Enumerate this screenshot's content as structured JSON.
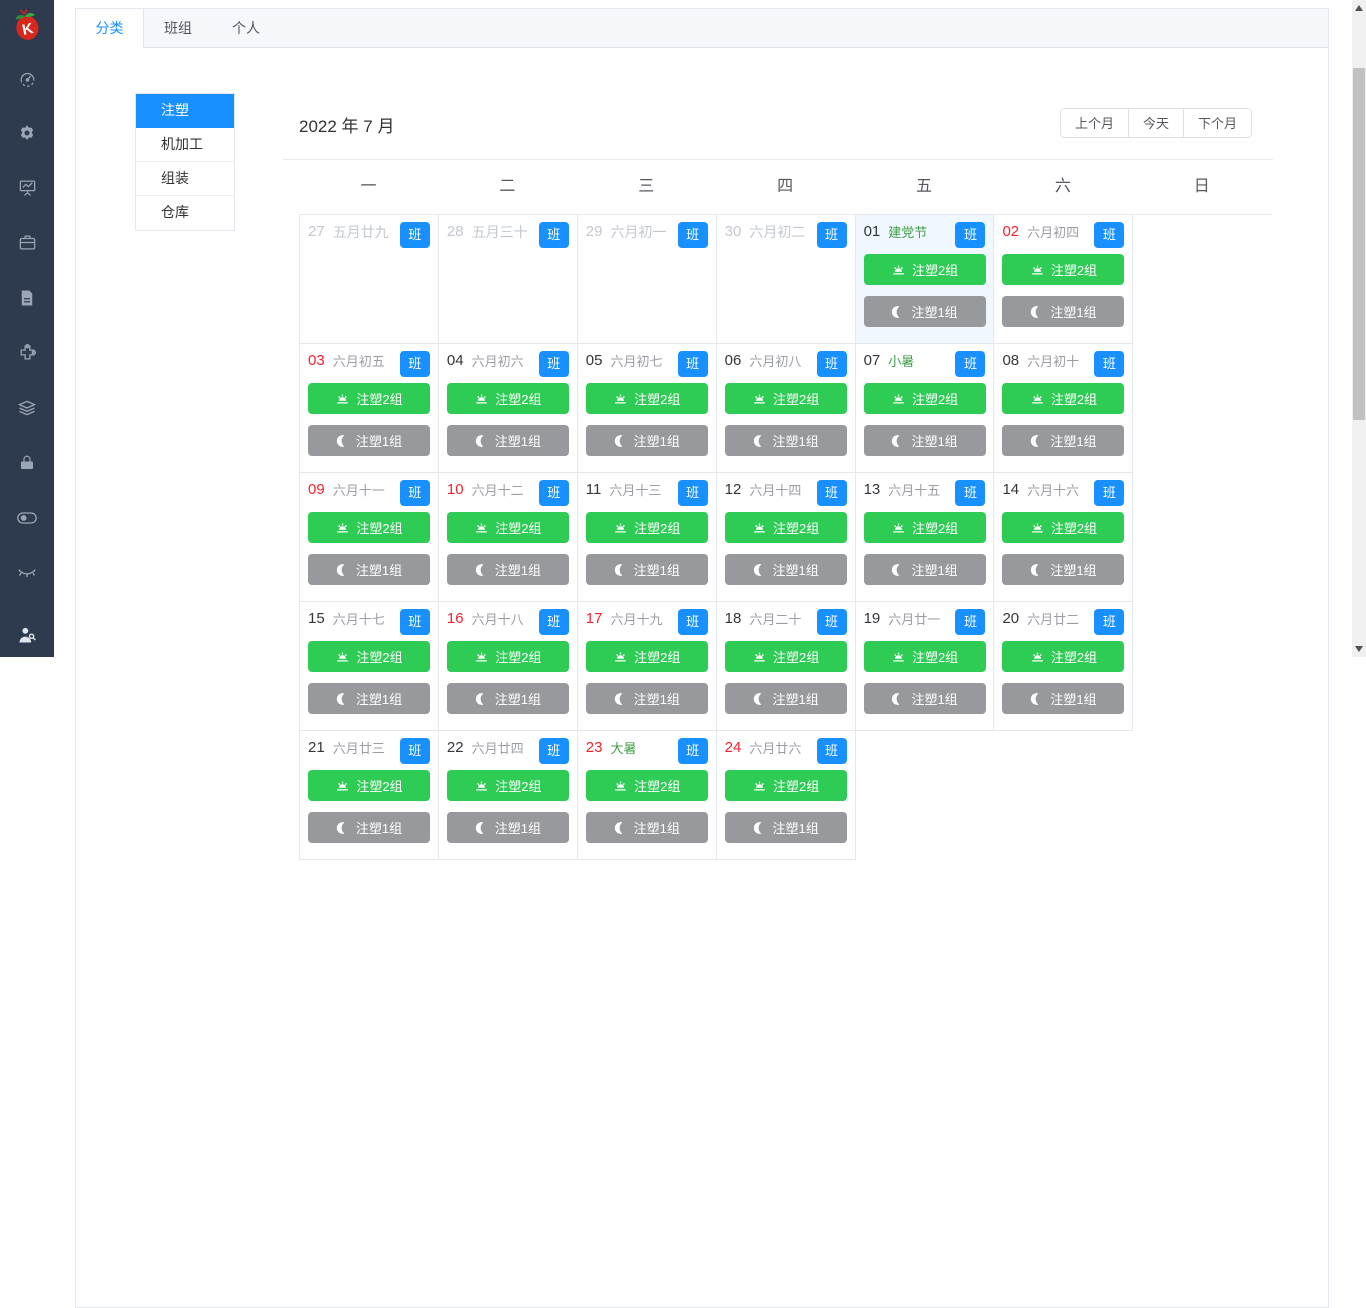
{
  "colors": {
    "primary_blue": "#1890ff",
    "shift_day_green": "#2ecc55",
    "shift_night_gray": "#97999c",
    "weekend_red": "#f5222d",
    "holiday_green": "#3f9e46",
    "sidebar_bg": "#2e3a4d",
    "prev_month_gray": "#c3c8d0",
    "today_cell_bg": "#f0f7fe"
  },
  "sidebar": {
    "logo": "app-logo-strawberry",
    "icons": [
      "dashboard-gauge-icon",
      "settings-gear-icon",
      "chart-board-icon",
      "briefcase-icon",
      "document-icon",
      "puzzle-icon",
      "layers-icon",
      "lock-icon",
      "toggle-icon",
      "eye-closed-icon"
    ],
    "bottom_icon": "users-icon"
  },
  "tabs": [
    {
      "label": "分类",
      "active": true
    },
    {
      "label": "班组",
      "active": false
    },
    {
      "label": "个人",
      "active": false
    }
  ],
  "category_menu": [
    {
      "label": "注塑",
      "selected": true
    },
    {
      "label": "机加工",
      "selected": false
    },
    {
      "label": "组装",
      "selected": false
    },
    {
      "label": "仓库",
      "selected": false
    }
  ],
  "calendar": {
    "title": "2022 年 7 月",
    "nav_buttons": [
      "上个月",
      "今天",
      "下个月"
    ],
    "weekdays": [
      "一",
      "二",
      "三",
      "四",
      "五",
      "六",
      "日"
    ],
    "badge_label": "班",
    "day_shift_label": "注塑2组",
    "night_shift_label": "注塑1组",
    "days": [
      {
        "day": "27",
        "lunar": "五月廿九",
        "num_style": "prev",
        "lunar_style": "prev",
        "highlight": false,
        "shifts": false
      },
      {
        "day": "28",
        "lunar": "五月三十",
        "num_style": "prev",
        "lunar_style": "prev",
        "highlight": false,
        "shifts": false
      },
      {
        "day": "29",
        "lunar": "六月初一",
        "num_style": "prev",
        "lunar_style": "prev",
        "highlight": false,
        "shifts": false
      },
      {
        "day": "30",
        "lunar": "六月初二",
        "num_style": "prev",
        "lunar_style": "prev",
        "highlight": false,
        "shifts": false
      },
      {
        "day": "01",
        "lunar": "建党节",
        "num_style": "normal",
        "lunar_style": "holiday",
        "highlight": true,
        "shifts": true
      },
      {
        "day": "02",
        "lunar": "六月初四",
        "num_style": "weekend",
        "lunar_style": "normal",
        "highlight": false,
        "shifts": true
      },
      {
        "day": "03",
        "lunar": "六月初五",
        "num_style": "weekend",
        "lunar_style": "normal",
        "highlight": false,
        "shifts": true
      },
      {
        "day": "04",
        "lunar": "六月初六",
        "num_style": "normal",
        "lunar_style": "normal",
        "highlight": false,
        "shifts": true
      },
      {
        "day": "05",
        "lunar": "六月初七",
        "num_style": "normal",
        "lunar_style": "normal",
        "highlight": false,
        "shifts": true
      },
      {
        "day": "06",
        "lunar": "六月初八",
        "num_style": "normal",
        "lunar_style": "normal",
        "highlight": false,
        "shifts": true
      },
      {
        "day": "07",
        "lunar": "小暑",
        "num_style": "normal",
        "lunar_style": "holiday",
        "highlight": false,
        "shifts": true
      },
      {
        "day": "08",
        "lunar": "六月初十",
        "num_style": "normal",
        "lunar_style": "normal",
        "highlight": false,
        "shifts": true
      },
      {
        "day": "09",
        "lunar": "六月十一",
        "num_style": "weekend",
        "lunar_style": "normal",
        "highlight": false,
        "shifts": true
      },
      {
        "day": "10",
        "lunar": "六月十二",
        "num_style": "weekend",
        "lunar_style": "normal",
        "highlight": false,
        "shifts": true
      },
      {
        "day": "11",
        "lunar": "六月十三",
        "num_style": "normal",
        "lunar_style": "normal",
        "highlight": false,
        "shifts": true
      },
      {
        "day": "12",
        "lunar": "六月十四",
        "num_style": "normal",
        "lunar_style": "normal",
        "highlight": false,
        "shifts": true
      },
      {
        "day": "13",
        "lunar": "六月十五",
        "num_style": "normal",
        "lunar_style": "normal",
        "highlight": false,
        "shifts": true
      },
      {
        "day": "14",
        "lunar": "六月十六",
        "num_style": "normal",
        "lunar_style": "normal",
        "highlight": false,
        "shifts": true
      },
      {
        "day": "15",
        "lunar": "六月十七",
        "num_style": "normal",
        "lunar_style": "normal",
        "highlight": false,
        "shifts": true
      },
      {
        "day": "16",
        "lunar": "六月十八",
        "num_style": "weekend",
        "lunar_style": "normal",
        "highlight": false,
        "shifts": true
      },
      {
        "day": "17",
        "lunar": "六月十九",
        "num_style": "weekend",
        "lunar_style": "normal",
        "highlight": false,
        "shifts": true
      },
      {
        "day": "18",
        "lunar": "六月二十",
        "num_style": "normal",
        "lunar_style": "normal",
        "highlight": false,
        "shifts": true
      },
      {
        "day": "19",
        "lunar": "六月廿一",
        "num_style": "normal",
        "lunar_style": "normal",
        "highlight": false,
        "shifts": true
      },
      {
        "day": "20",
        "lunar": "六月廿二",
        "num_style": "normal",
        "lunar_style": "normal",
        "highlight": false,
        "shifts": true
      },
      {
        "day": "21",
        "lunar": "六月廿三",
        "num_style": "normal",
        "lunar_style": "normal",
        "highlight": false,
        "shifts": true
      },
      {
        "day": "22",
        "lunar": "六月廿四",
        "num_style": "normal",
        "lunar_style": "normal",
        "highlight": false,
        "shifts": true
      },
      {
        "day": "23",
        "lunar": "大暑",
        "num_style": "weekend",
        "lunar_style": "holiday",
        "highlight": false,
        "shifts": true
      },
      {
        "day": "24",
        "lunar": "六月廿六",
        "num_style": "weekend",
        "lunar_style": "normal",
        "highlight": false,
        "shifts": true
      }
    ]
  }
}
